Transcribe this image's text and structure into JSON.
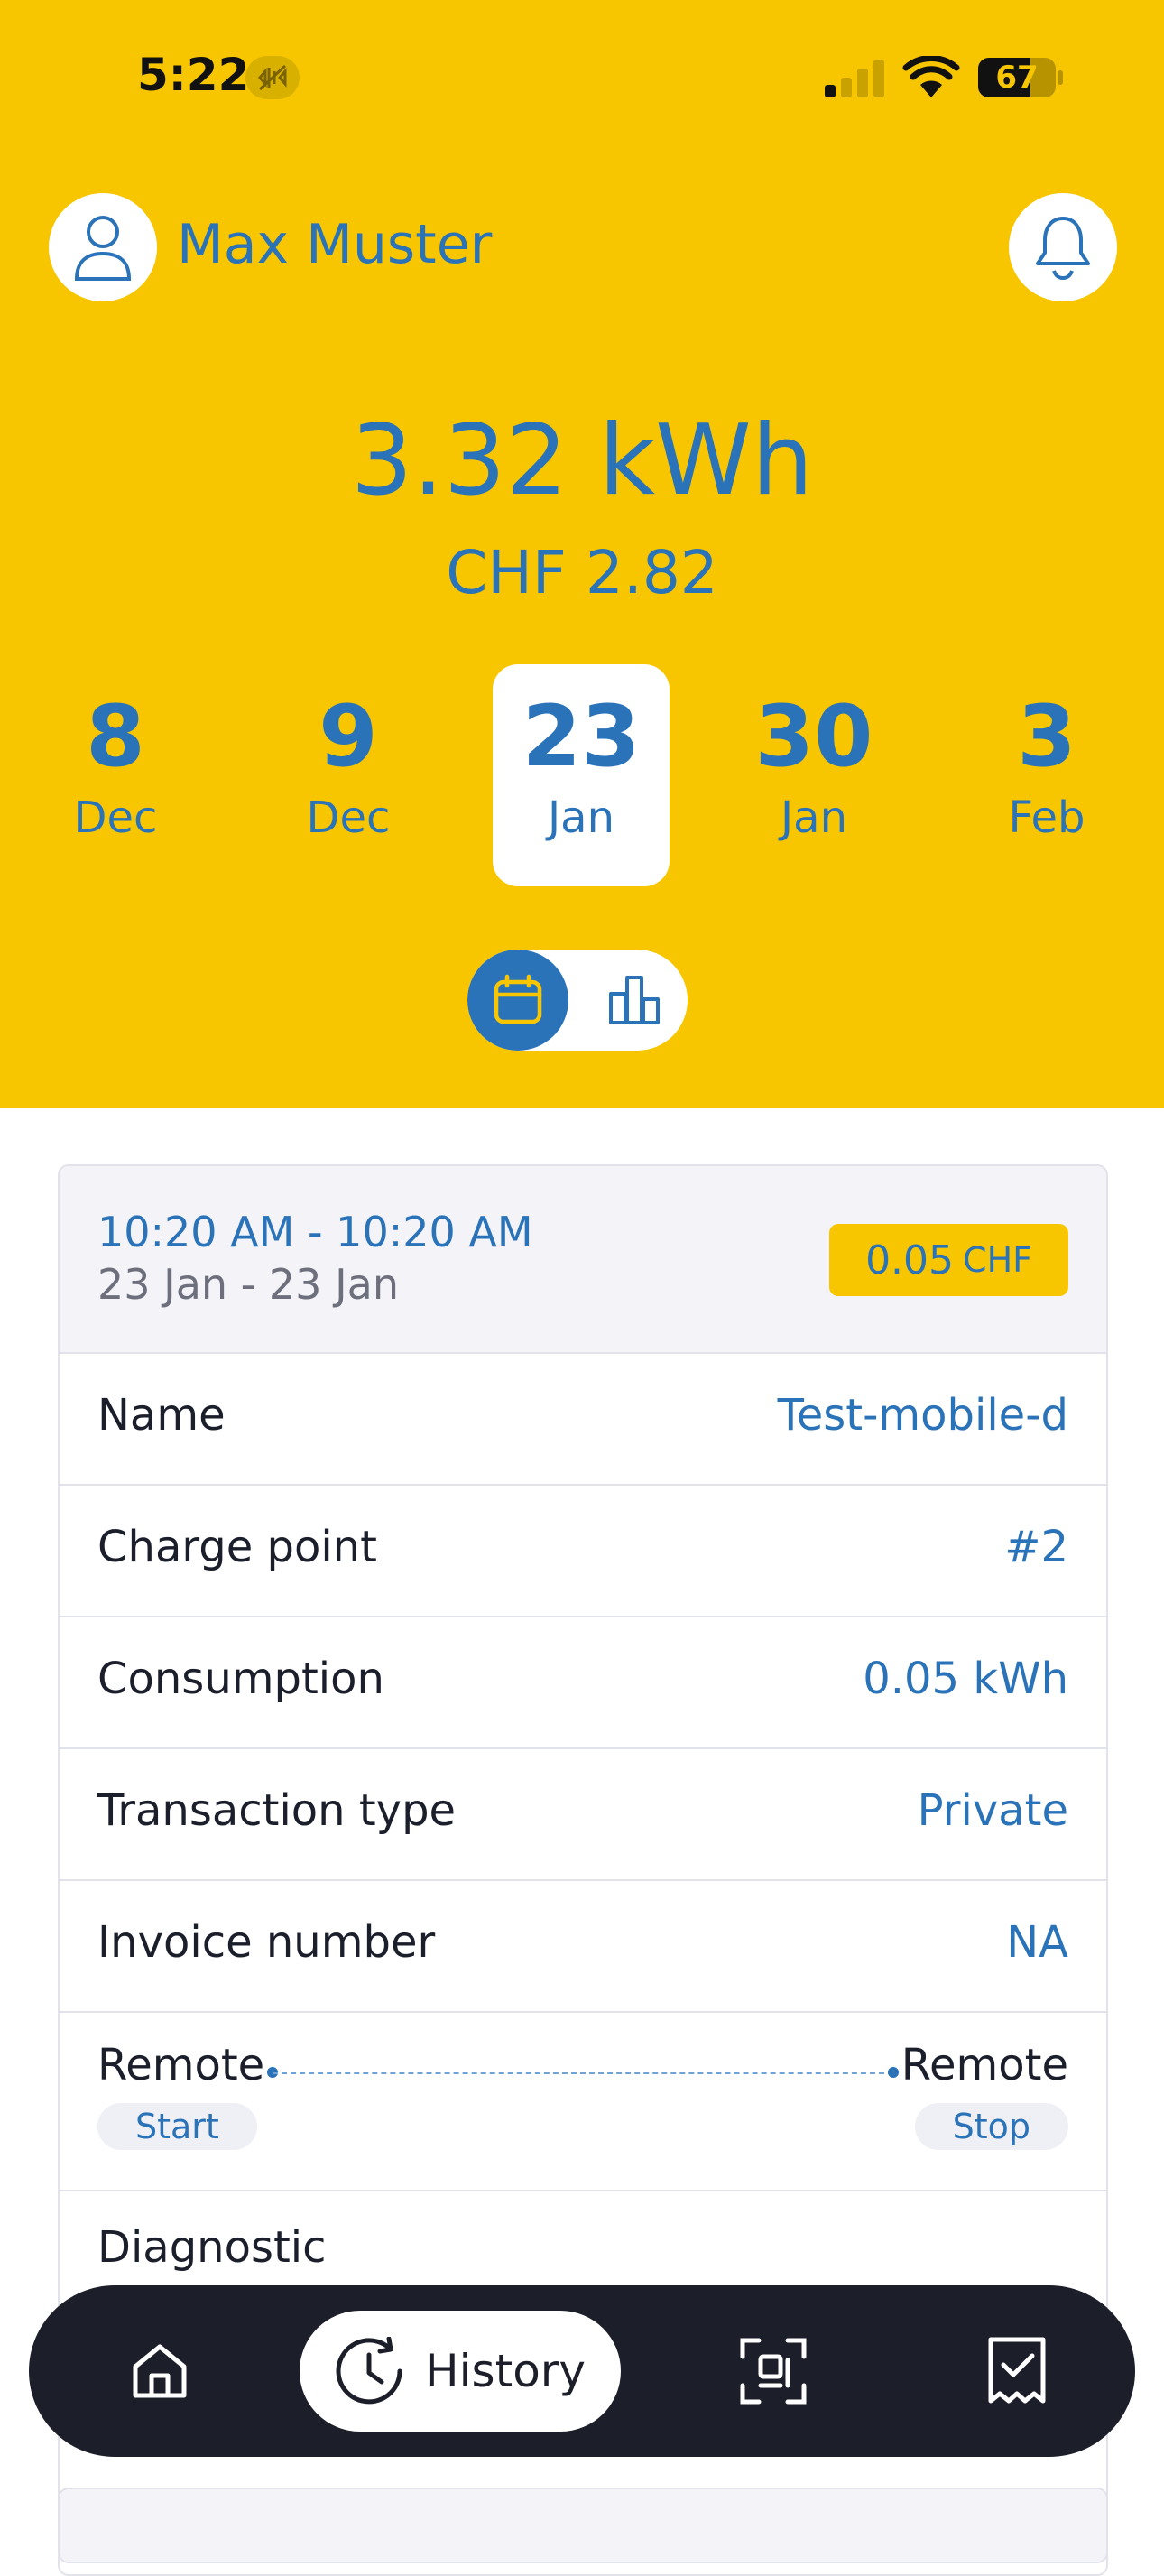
{
  "status_bar": {
    "time": "5:22",
    "battery": "67",
    "battery_level": 67,
    "icons": [
      "mute-icon",
      "cellular-signal-icon",
      "wifi-icon",
      "battery-icon"
    ]
  },
  "header": {
    "username": "Max Muster",
    "energy": "3.32 kWh",
    "cost": "CHF 2.82",
    "dates": [
      {
        "day": "8",
        "month": "Dec",
        "selected": false
      },
      {
        "day": "9",
        "month": "Dec",
        "selected": false
      },
      {
        "day": "23",
        "month": "Jan",
        "selected": true
      },
      {
        "day": "30",
        "month": "Jan",
        "selected": false
      },
      {
        "day": "3",
        "month": "Feb",
        "selected": false
      }
    ],
    "view_toggle": [
      "calendar-icon",
      "bar-chart-icon"
    ]
  },
  "session": {
    "times": "10:20 AM - 10:20 AM",
    "range": "23 Jan - 23 Jan",
    "price_value": "0.05",
    "price_currency": "CHF",
    "rows": [
      {
        "label": "Name",
        "value": "Test-mobile-d"
      },
      {
        "label": "Charge point",
        "value": "#2"
      },
      {
        "label": "Consumption",
        "value": "0.05 kWh"
      },
      {
        "label": "Transaction type",
        "value": "Private"
      },
      {
        "label": "Invoice number",
        "value": "NA"
      }
    ],
    "remote": {
      "start_label": "Remote",
      "start_tag": "Start",
      "stop_label": "Remote",
      "stop_tag": "Stop"
    },
    "diagnostic_label": "Diagnostic"
  },
  "nav": {
    "history_label": "History",
    "icons": [
      "home-icon",
      "history-icon",
      "scan-icon",
      "invoice-icon"
    ]
  },
  "colors": {
    "brand_yellow": "#f7c600",
    "brand_blue": "#2b73b8",
    "nav_dark": "#1c1e29"
  }
}
